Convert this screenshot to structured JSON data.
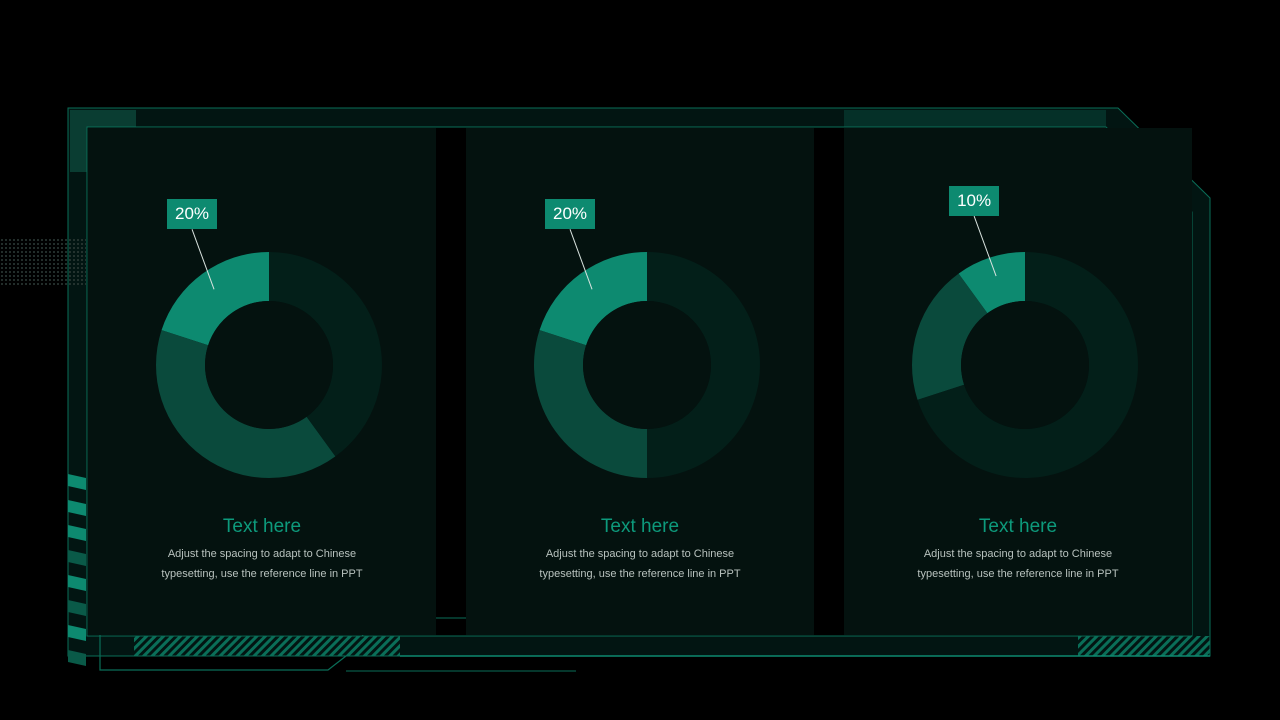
{
  "colors": {
    "background": "#000000",
    "panel": "#04120f",
    "accent": "#0d8a70",
    "accent_mid": "#0a4a3c",
    "accent_dark": "#031f19",
    "center": "#04120f",
    "title": "#0d9a7c",
    "desc": "#b8c2be"
  },
  "chart_data": [
    {
      "type": "pie",
      "values": [
        20,
        40,
        40
      ],
      "highlight_label": "20%",
      "title": "Text here",
      "description": [
        "Adjust the spacing to adapt to Chinese",
        "typesetting, use the reference line in PPT"
      ]
    },
    {
      "type": "pie",
      "values": [
        20,
        30,
        50
      ],
      "highlight_label": "20%",
      "title": "Text here",
      "description": [
        "Adjust the spacing to adapt to Chinese",
        "typesetting, use the reference line in PPT"
      ]
    },
    {
      "type": "pie",
      "values": [
        10,
        20,
        70
      ],
      "highlight_label": "10%",
      "title": "Text here",
      "description": [
        "Adjust the spacing to adapt to Chinese",
        "typesetting, use the reference line in PPT"
      ]
    }
  ]
}
